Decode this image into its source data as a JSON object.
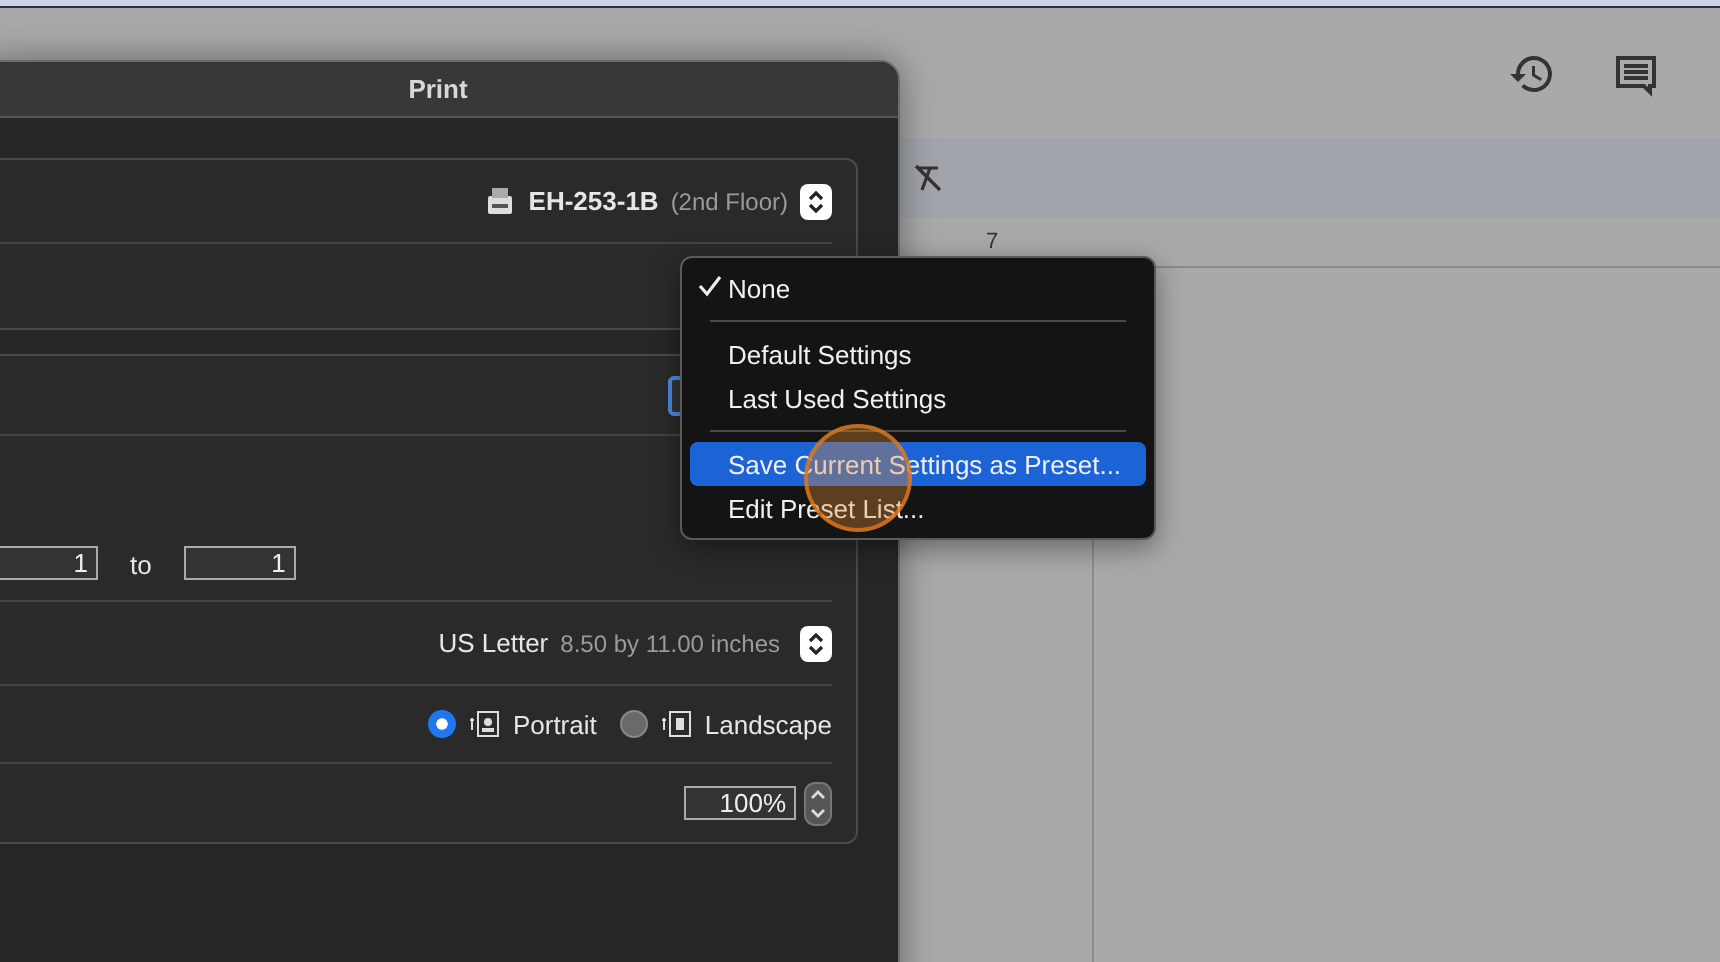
{
  "ruler": {
    "label": "7"
  },
  "dialog": {
    "title": "Print",
    "printer": {
      "name": "EH-253-1B",
      "location": "(2nd Floor)"
    },
    "pages": {
      "from": "1",
      "separator": "to",
      "to": "1"
    },
    "paper_size": {
      "name": "US Letter",
      "dimensions": "8.50 by 11.00 inches"
    },
    "orientation": [
      {
        "label": "Portrait",
        "selected": true
      },
      {
        "label": "Landscape",
        "selected": false
      }
    ],
    "scale": {
      "value": "100%"
    }
  },
  "presets_menu": {
    "groups": [
      {
        "items": [
          {
            "label": "None",
            "checked": true,
            "selected": false
          }
        ]
      },
      {
        "items": [
          {
            "label": "Default Settings",
            "checked": false,
            "selected": false
          },
          {
            "label": "Last Used Settings",
            "checked": false,
            "selected": false
          }
        ]
      },
      {
        "items": [
          {
            "label": "Save Current Settings as Preset...",
            "checked": false,
            "selected": true
          },
          {
            "label": "Edit Preset List...",
            "checked": false,
            "selected": false
          }
        ]
      }
    ]
  }
}
